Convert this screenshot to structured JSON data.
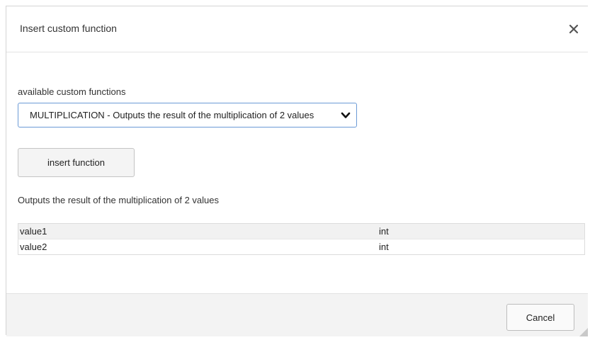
{
  "dialog": {
    "title": "Insert custom function",
    "close_icon": "close-icon"
  },
  "body": {
    "select_label": "available custom functions",
    "select_value": "MULTIPLICATION - Outputs the result of the multiplication of 2 values",
    "insert_button_label": "insert function",
    "description": "Outputs the result of the multiplication of 2 values",
    "parameters": [
      {
        "name": "value1",
        "type": "int"
      },
      {
        "name": "value2",
        "type": "int"
      }
    ]
  },
  "footer": {
    "cancel_label": "Cancel"
  },
  "colors": {
    "select_border": "#6b9ad6",
    "footer_bg": "#f3f3f3",
    "table_header_bg": "#f1f1f1"
  }
}
